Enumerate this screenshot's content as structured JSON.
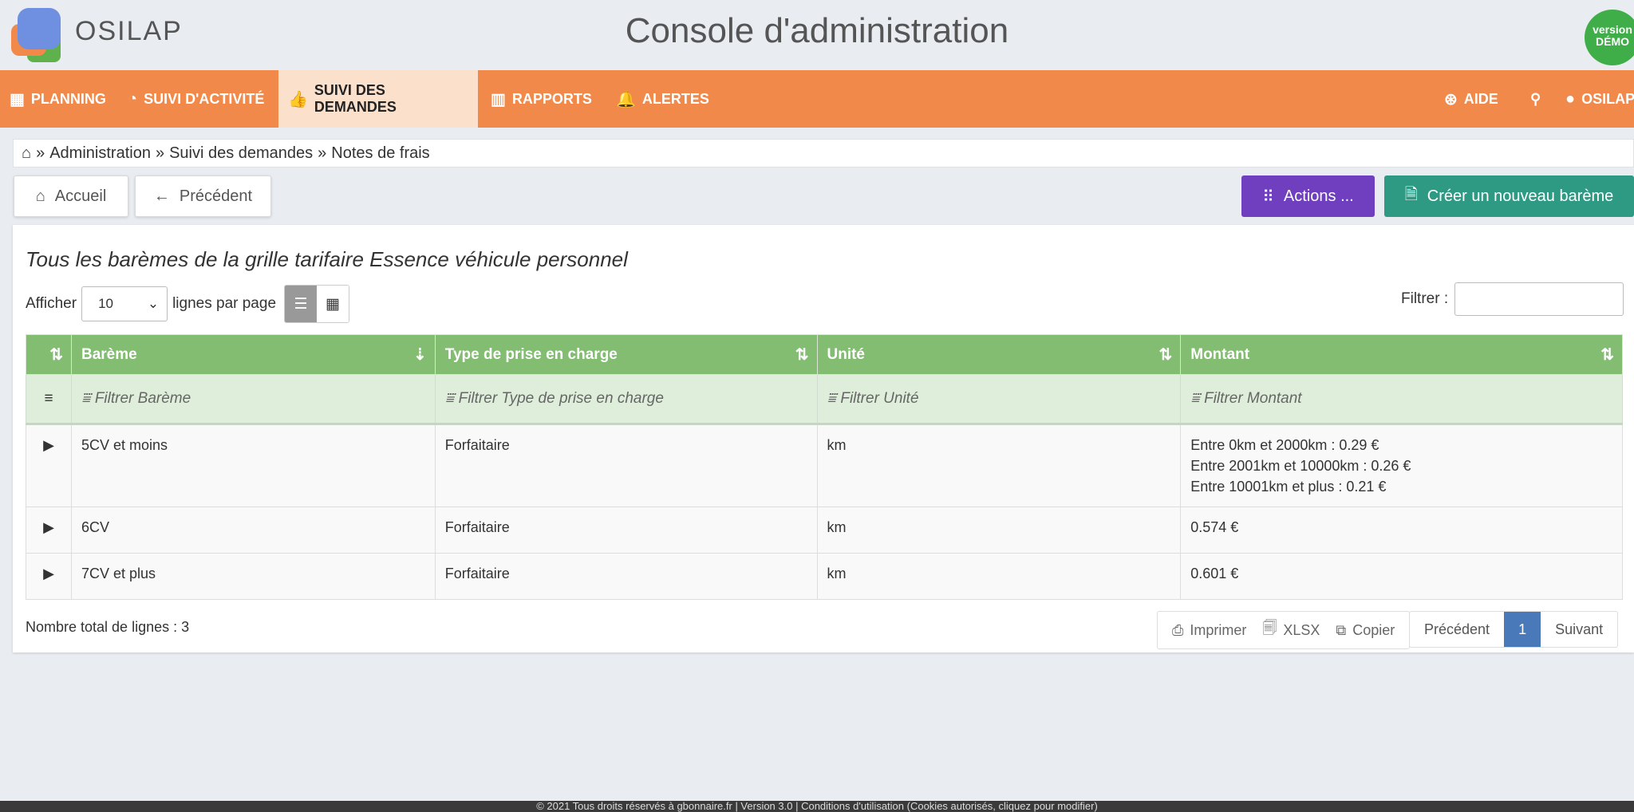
{
  "header": {
    "brand": "OSILAP",
    "title": "Console d'administration",
    "badge_line1": "version",
    "badge_line2": "DÉMO"
  },
  "nav": {
    "planning": "PLANNING",
    "suivi_activite": "SUIVI D'ACTIVITÉ",
    "suivi_demandes": "SUIVI DES DEMANDES",
    "rapports": "RAPPORTS",
    "alertes": "ALERTES",
    "aide": "AIDE",
    "user": "OSILAP"
  },
  "breadcrumb": {
    "items": [
      "Administration",
      "Suivi des demandes",
      "Notes de frais"
    ]
  },
  "toolbar": {
    "home": "Accueil",
    "previous": "Précédent",
    "actions": "Actions ...",
    "create": "Créer un nouveau barème"
  },
  "panel": {
    "title": "Tous les barèmes de la grille tarifaire Essence véhicule personnel",
    "show_label": "Afficher",
    "page_size": "10",
    "per_page_label": "lignes par page",
    "filter_label": "Filtrer :"
  },
  "table": {
    "headers": [
      "Barème",
      "Type de prise en charge",
      "Unité",
      "Montant"
    ],
    "filters": [
      "Filtrer Barème",
      "Filtrer Type de prise en charge",
      "Filtrer Unité",
      "Filtrer Montant"
    ],
    "rows": [
      {
        "bareme": "5CV et moins",
        "type": "Forfaitaire",
        "unite": "km",
        "montant": [
          "Entre 0km et 2000km : 0.29 €",
          "Entre 2001km et 10000km : 0.26 €",
          "Entre 10001km et plus : 0.21 €"
        ]
      },
      {
        "bareme": "6CV",
        "type": "Forfaitaire",
        "unite": "km",
        "montant": [
          "0.574 €"
        ]
      },
      {
        "bareme": "7CV et plus",
        "type": "Forfaitaire",
        "unite": "km",
        "montant": [
          "0.601 €"
        ]
      }
    ]
  },
  "bottom": {
    "total": "Nombre total de lignes : 3",
    "print": "Imprimer",
    "xlsx": "XLSX",
    "copy": "Copier",
    "prev": "Précédent",
    "page": "1",
    "next": "Suivant"
  },
  "footer": {
    "text": "© 2021 Tous droits réservés à gbonnaire.fr | Version 3.0 | Conditions d'utilisation (Cookies autorisés, cliquez pour modifier)"
  },
  "colors": {
    "nav": "#f0894a",
    "table_header": "#82bd72",
    "actions_button": "#6f3fbf",
    "create_button": "#2f9a84",
    "pager_active": "#4a79ba"
  }
}
